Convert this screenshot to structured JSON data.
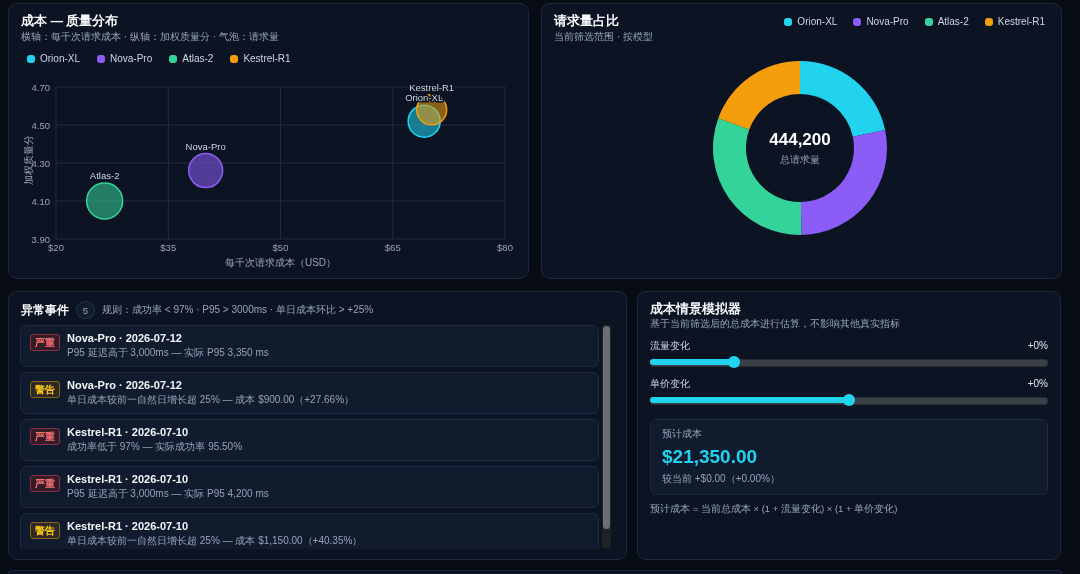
{
  "cost_quality": {
    "title": "成本 — 质量分布",
    "subtitle": "横轴：每千次请求成本 · 纵轴：加权质量分 · 气泡：请求量",
    "chart_data": {
      "type": "scatter",
      "xlabel": "每千次请求成本（USD）",
      "ylabel": "加权质量分",
      "xlim": [
        20,
        80
      ],
      "ylim": [
        3.9,
        4.7
      ],
      "xticks": [
        {
          "value": 20,
          "label": "$20"
        },
        {
          "value": 35,
          "label": "$35"
        },
        {
          "value": 50,
          "label": "$50"
        },
        {
          "value": 65,
          "label": "$65"
        },
        {
          "value": 80,
          "label": "$80"
        }
      ],
      "yticks": [
        {
          "value": 3.9,
          "label": "3.90"
        },
        {
          "value": 4.1,
          "label": "4.10"
        },
        {
          "value": 4.3,
          "label": "4.30"
        },
        {
          "value": 4.5,
          "label": "4.50"
        },
        {
          "value": 4.7,
          "label": "4.70"
        }
      ],
      "grid": true,
      "legend": "top-left",
      "series": [
        {
          "name": "Orion-XL",
          "color": "#22d3ee",
          "x": [
            69.2
          ],
          "values": [
            4.52
          ]
        },
        {
          "name": "Nova-Pro",
          "color": "#8b5cf6",
          "x": [
            40.0
          ],
          "values": [
            4.26
          ]
        },
        {
          "name": "Atlas-2",
          "color": "#34d399",
          "x": [
            26.5
          ],
          "values": [
            4.1
          ]
        },
        {
          "name": "Kestrel-R1",
          "color": "#f59e0b",
          "x": [
            70.2
          ],
          "values": [
            4.58
          ]
        }
      ],
      "annotations": [
        {
          "text": "Orion-XL",
          "x": 69.2,
          "y": 4.52
        },
        {
          "text": "Nova-Pro",
          "x": 40.0,
          "y": 4.26
        },
        {
          "text": "Atlas-2",
          "x": 26.5,
          "y": 4.1
        },
        {
          "text": "Kestrel-R1",
          "x": 70.2,
          "y": 4.58
        }
      ]
    }
  },
  "request_share": {
    "title": "请求量占比",
    "subtitle": "当前筛选范围 · 按模型",
    "legend": [
      {
        "label": "Orion-XL",
        "color": "#22d3ee"
      },
      {
        "label": "Nova-Pro",
        "color": "#8b5cf6"
      },
      {
        "label": "Atlas-2",
        "color": "#34d399"
      },
      {
        "label": "Kestrel-R1",
        "color": "#f59e0b"
      }
    ],
    "total": "444,200",
    "total_label": "总请求量"
  },
  "anomalies": {
    "title": "异常事件",
    "count": "5",
    "rules": "规则：成功率 < 97% · P95 > 3000ms · 单日成本环比 > +25%",
    "events": [
      {
        "kind": "critical",
        "tag": "严重",
        "title": "Nova-Pro · 2026-07-12",
        "detail": "P95 延迟高于 3,000ms — 实际 P95 3,350 ms"
      },
      {
        "kind": "warning",
        "tag": "警告",
        "title": "Nova-Pro · 2026-07-12",
        "detail": "单日成本较前一自然日增长超 25% — 成本 $900.00（+27.66%）"
      },
      {
        "kind": "critical",
        "tag": "严重",
        "title": "Kestrel-R1 · 2026-07-10",
        "detail": "成功率低于 97% — 实际成功率 95.50%"
      },
      {
        "kind": "critical",
        "tag": "严重",
        "title": "Kestrel-R1 · 2026-07-10",
        "detail": "P95 延迟高于 3,000ms — 实际 P95 4,200 ms"
      },
      {
        "kind": "warning",
        "tag": "警告",
        "title": "Kestrel-R1 · 2026-07-10",
        "detail": "单日成本较前一自然日增长超 25% — 成本 $1,150.00（+40.35%）"
      }
    ]
  },
  "simulator": {
    "title": "成本情景模拟器",
    "subtitle": "基于当前筛选后的总成本进行估算，不影响其他真实指标",
    "sliders": [
      {
        "label": "流量变化",
        "reading": "+0%",
        "level": 0.21
      },
      {
        "label": "单价变化",
        "reading": "+0%",
        "level": 0.5
      }
    ],
    "result": {
      "label": "预计成本",
      "value": "$21,350.00",
      "delta": "较当前 +$0.00（+0.00%）"
    },
    "formula": "预计成本 = 当前总成本 × (1 + 流量变化) × (1 + 单价变化)"
  }
}
